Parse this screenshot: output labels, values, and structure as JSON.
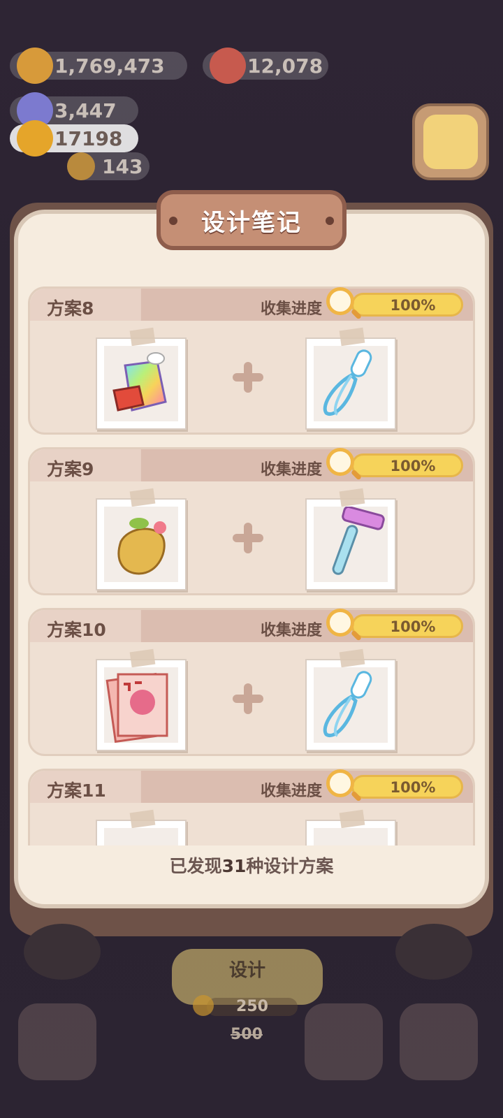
{
  "currencies": [
    {
      "name": "cookie",
      "value": "1,769,473",
      "color": "#d79a3a"
    },
    {
      "name": "berry",
      "value": "12,078",
      "color": "#d65a50"
    },
    {
      "name": "gem",
      "value": "3,447",
      "color": "#7c7acf"
    },
    {
      "name": "sunflower",
      "value": "17198",
      "color": "#e5a52a"
    },
    {
      "name": "bear",
      "value": "143",
      "color": "#d8a04a"
    }
  ],
  "dialog": {
    "title": "设计笔记",
    "footer_prefix": "已发现",
    "footer_count": "31",
    "footer_suffix": "种设计方案"
  },
  "plans": [
    {
      "name": "方案8",
      "progress_label": "收集进度",
      "progress": "100%",
      "left_item": "rainbow-jar-icon",
      "right_item": "whisk-icon"
    },
    {
      "name": "方案9",
      "progress_label": "收集进度",
      "progress": "100%",
      "left_item": "mandrake-root-icon",
      "right_item": "razor-icon"
    },
    {
      "name": "方案10",
      "progress_label": "收集进度",
      "progress": "100%",
      "left_item": "magazine-icon",
      "right_item": "whisk-icon"
    },
    {
      "name": "方案11",
      "progress_label": "收集进度",
      "progress": "100%",
      "left_item": "magazine-icon",
      "right_item": "razor-icon"
    }
  ],
  "bottom": {
    "design_label": "设计",
    "design_cost": "250",
    "design_old_cost": "500"
  },
  "colors": {
    "accent_gold": "#f6d35a",
    "panel": "#f6ecdf",
    "title_bg": "#c58f75"
  }
}
